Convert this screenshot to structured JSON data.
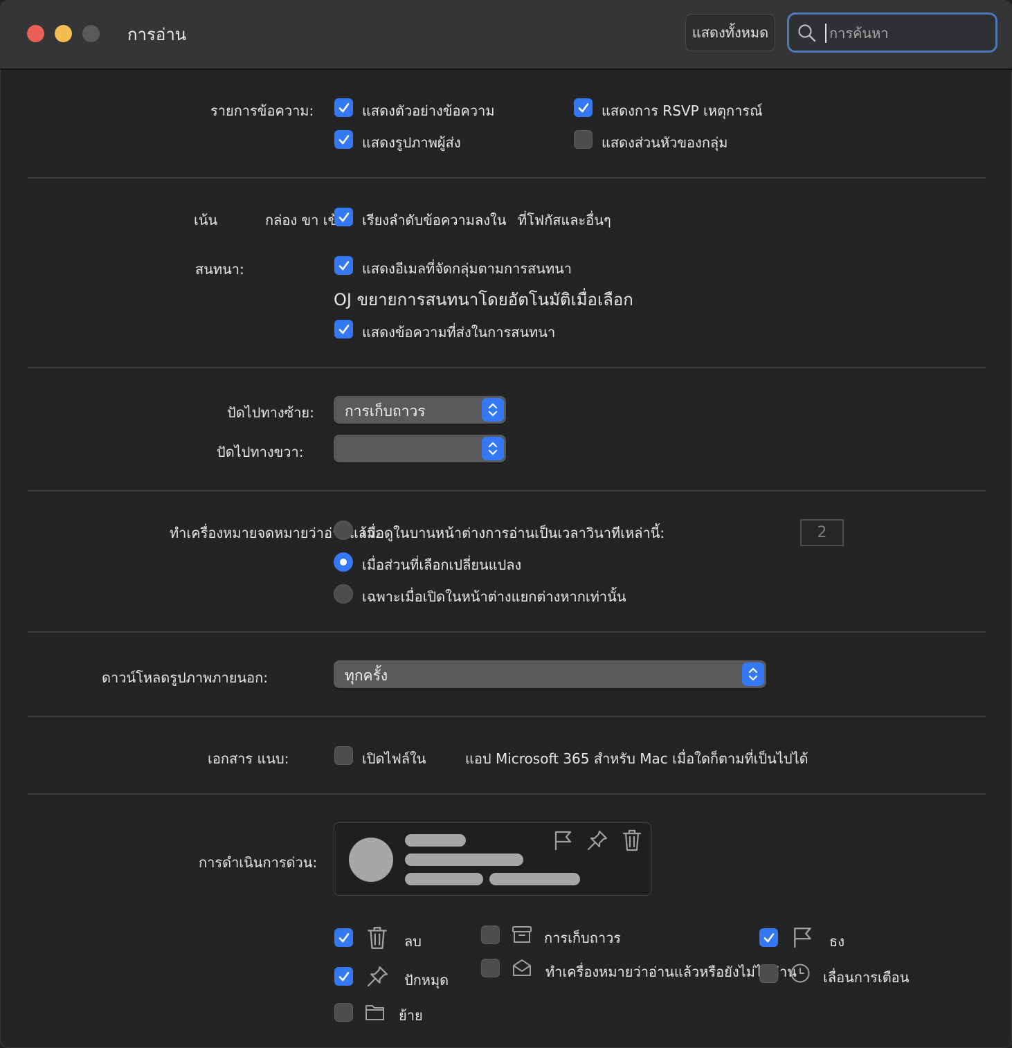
{
  "window": {
    "title": "การอ่าน",
    "show_all": "แสดงทั้งหมด",
    "search_placeholder": "การค้นหา"
  },
  "message_list": {
    "label": "รายการข้อความ:",
    "options": [
      {
        "label": "แสดงตัวอย่างข้อความ",
        "checked": true
      },
      {
        "label": "แสดงการ RSVP เหตุการณ์",
        "checked": true
      },
      {
        "label": "แสดงรูปภาพผู้ส่ง",
        "checked": true
      },
      {
        "label": "แสดงส่วนหัวของกลุ่ม",
        "checked": false
      }
    ]
  },
  "focused": {
    "label_a": "เน้น",
    "label_b": "กล่อง ขา เข้า",
    "option_a": "เรียงลำดับข้อความลงใน",
    "option_b": "ที่โฟกัสและอื่นๆ",
    "checked": true
  },
  "conversations": {
    "label": "สนทนา:",
    "options": [
      {
        "label": "แสดงอีเมลที่จัดกลุ่มตามการสนทนา",
        "checked": true
      },
      {
        "label": "OJ ขยายการสนทนาโดยอัตโนมัติเมื่อเลือก"
      },
      {
        "label": "แสดงข้อความที่ส่งในการสนทนา",
        "checked": true
      }
    ]
  },
  "swipe": {
    "left_label": "ปัดไปทางซ้าย:",
    "left_value": "การเก็บถาวร",
    "right_label": "ปัดไปทางขวา:",
    "right_value": ""
  },
  "mark_read": {
    "label": "ทำเครื่องหมายจดหมายว่าอ่านแล้ว:",
    "options": [
      {
        "label": "เมื่อดูในบานหน้าต่างการอ่านเป็นเวลาวินาทีเหล่านี้:",
        "selected": false
      },
      {
        "label": "เมื่อส่วนที่เลือกเปลี่ยนแปลง",
        "selected": true
      },
      {
        "label": "เฉพาะเมื่อเปิดในหน้าต่างแยกต่างหากเท่านั้น",
        "selected": false
      }
    ],
    "seconds": "2"
  },
  "external_images": {
    "label": "ดาวน์โหลดรูปภาพภายนอก:",
    "value": "ทุกครั้ง"
  },
  "attachments": {
    "label": "เอกสาร แนบ:",
    "option_a": "เปิดไฟล์ใน",
    "option_b": "แอป Microsoft 365 สำหรับ Mac เมื่อใดก็ตามที่เป็นไปได้",
    "checked": false
  },
  "quick_actions": {
    "label": "การดำเนินการด่วน:",
    "preview_icons": [
      "flag-icon",
      "pin-icon",
      "trash-icon"
    ],
    "items": [
      {
        "label": "ลบ",
        "icon": "trash-icon",
        "checked": true
      },
      {
        "label": "การเก็บถาวร",
        "icon": "archive-icon",
        "checked": false
      },
      {
        "label": "ธง",
        "icon": "flag-icon",
        "checked": true
      },
      {
        "label": "ปักหมุด",
        "icon": "pin-icon",
        "checked": true
      },
      {
        "label": "ทำเครื่องหมายว่าอ่านแล้วหรือยังไม่ได้อ่าน",
        "icon": "envelope-open-icon",
        "checked": false
      },
      {
        "label": "เลื่อนการเตือน",
        "icon": "clock-icon",
        "checked": false
      },
      {
        "label": "ย้าย",
        "icon": "folder-icon",
        "checked": false
      }
    ]
  },
  "colors": {
    "accent": "#3478f6",
    "close": "#ec5f57",
    "minimize": "#f3be4f",
    "background": "#242427"
  }
}
